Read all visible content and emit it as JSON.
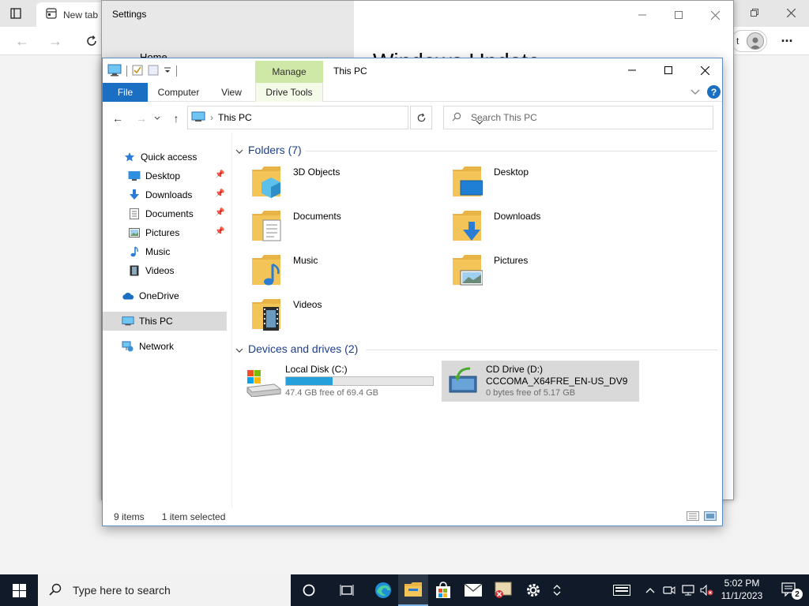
{
  "browser": {
    "tab_label": "New tab",
    "profile_letter": "t"
  },
  "settings": {
    "title": "Settings",
    "home_label": "Home",
    "heading": "Windows Update"
  },
  "explorer": {
    "title": "This PC",
    "contextual_tab_group": "Manage",
    "ribbon_tabs": [
      "File",
      "Computer",
      "View",
      "Drive Tools"
    ],
    "address": "This PC",
    "search_placeholder": "Search This PC",
    "nav": {
      "quick_access": "Quick access",
      "desktop": "Desktop",
      "downloads": "Downloads",
      "documents": "Documents",
      "pictures": "Pictures",
      "music": "Music",
      "videos": "Videos",
      "onedrive": "OneDrive",
      "this_pc": "This PC",
      "network": "Network"
    },
    "folders_header": "Folders (7)",
    "folders": [
      "3D Objects",
      "Desktop",
      "Documents",
      "Downloads",
      "Music",
      "Pictures",
      "Videos"
    ],
    "devices_header": "Devices and drives (2)",
    "drives": [
      {
        "name": "Local Disk (C:)",
        "free": "47.4 GB free of 69.4 GB",
        "used_fraction": 0.317
      },
      {
        "name": "CD Drive (D:)",
        "label": "CCCOMA_X64FRE_EN-US_DV9",
        "free": "0 bytes free of 5.17 GB"
      }
    ],
    "status": {
      "items": "9 items",
      "selected": "1 item selected"
    }
  },
  "taskbar": {
    "search_placeholder": "Type here to search",
    "time": "5:02 PM",
    "date": "11/1/2023",
    "notification_count": "2"
  },
  "colors": {
    "accent": "#1a6fc2",
    "manage_tab": "#cfe8a8",
    "folder": "#f3c457",
    "progress": "#26a0da",
    "taskbar": "#101a28"
  }
}
